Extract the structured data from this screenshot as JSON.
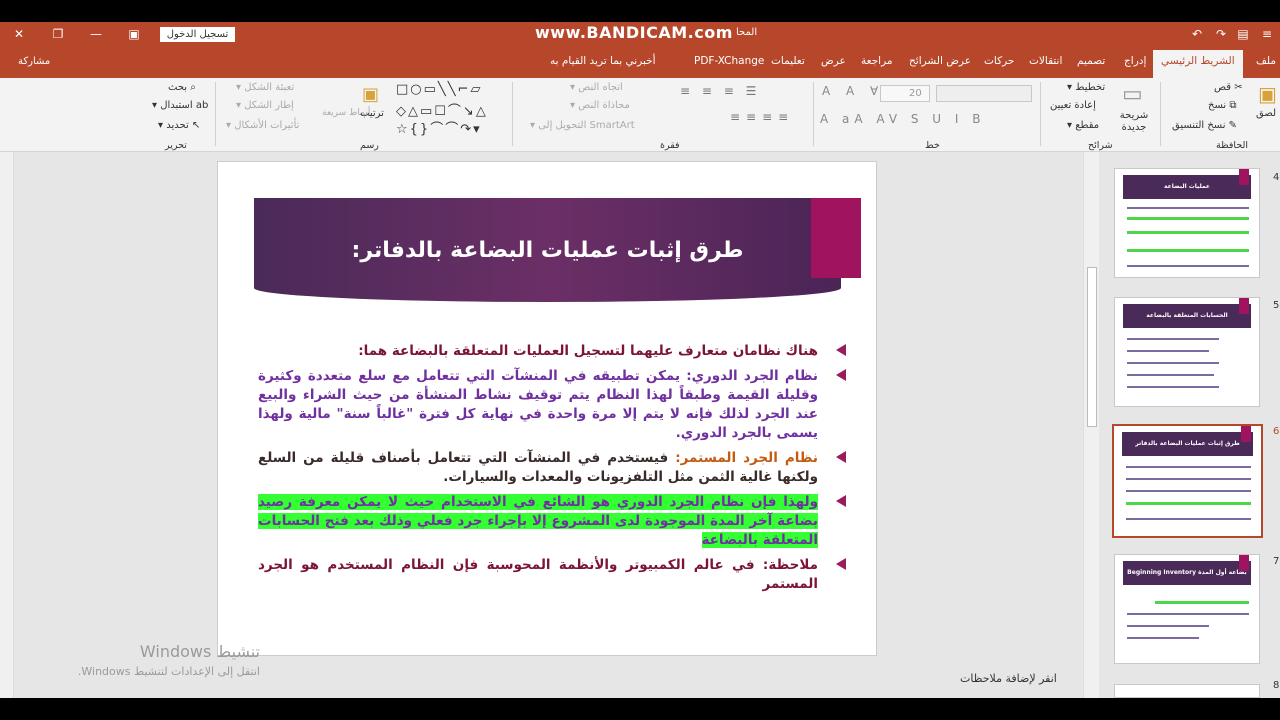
{
  "titlebar": {
    "login_label": "تسجيل الدخول",
    "watermark": "www.BANDICAM.com",
    "doc_title": "المحا"
  },
  "tabs": {
    "share_label": "مشاركة",
    "items": [
      "ملف",
      "الشريط الرئيسي",
      "إدراج",
      "تصميم",
      "انتقالات",
      "حركات",
      "عرض الشرائح",
      "مراجعة",
      "عرض",
      "تعليمات",
      "PDF-XChange",
      "أخبرني بما تريد القيام به"
    ]
  },
  "ribbon": {
    "clipboard": {
      "label": "الحافظة",
      "paste": "لصق",
      "cut": "قص",
      "copy": "نسخ",
      "format_painter": "نسخ التنسيق"
    },
    "slides": {
      "label": "شرائح",
      "new_slide": "شريحة جديدة",
      "layout": "تخطيط",
      "reset": "إعادة تعيين",
      "section": "مقطع"
    },
    "font": {
      "label": "خط",
      "size": "20"
    },
    "paragraph": {
      "label": "فقرة",
      "text_direction": "اتجاه النص",
      "align_text": "محاذاة النص",
      "smartart": "التحويل إلى SmartArt"
    },
    "drawing": {
      "label": "رسم",
      "arrange": "ترتيب",
      "quick_styles": "أنماط سريعة",
      "shape_fill": "تعبئة الشكل",
      "shape_outline": "إطار الشكل",
      "shape_effects": "تأثيرات الأشكال"
    },
    "editing": {
      "label": "تحرير",
      "find": "بحث",
      "replace": "استبدال",
      "select": "تحديد"
    }
  },
  "slide": {
    "title": "طرق إثبات عمليات البضاعة بالدفاتر:",
    "bullets": [
      {
        "text": "هناك نظامان متعارف عليهما لتسجيل العمليات المتعلقة بالبضاعة هما:"
      },
      {
        "lead": "نظام الجرد الدوري:",
        "text": " يمكن تطبيقه في المنشآت التي تتعامل مع سلع متعددة وكثيرة وقليلة القيمة وطبقاً لهذا النظام يتم توقيف نشاط المنشأة من حيث الشراء والبيع عند الجرد لذلك فإنه لا يتم إلا مرة واحدة في نهاية كل فترة \"غالباً سنة\" مالية ولهذا يسمى بالجرد الدوري."
      },
      {
        "lead": "نظام الجرد المستمر:",
        "text": " فيستخدم في المنشآت التي تتعامل بأصناف قليلة من السلع ولكنها غالية الثمن مثل التلفزيونات والمعدات والسيارات."
      },
      {
        "text": "ولهذا فإن نظام الجرد الدوري هو الشائع في الاستخدام حيث لا يمكن معرفة رصيد بضاعة آخر المدة الموجودة لدى المشروع إلا بإجراء جرد فعلي وذلك بعد فتح الحسابات المتعلقة بالبضاعة"
      },
      {
        "text": "ملاحظة: في عالم الكمبيوتر والأنظمة المحوسبة فإن النظام المستخدم هو الجرد المستمر"
      }
    ]
  },
  "thumbnails": [
    {
      "number": "4",
      "title": "عمليات البضاعة"
    },
    {
      "number": "5",
      "title": "الحسابات المتعلقة بالبضاعة"
    },
    {
      "number": "6",
      "title": "طرق إثبات عمليات البضاعة بالدفاتر"
    },
    {
      "number": "7",
      "title": "Beginning Inventory بضاعة أول المدة"
    },
    {
      "number": "8",
      "title": ""
    }
  ],
  "windows_activation": {
    "title": "تنشيط Windows",
    "subtitle": "انتقل إلى الإعدادات لتنشيط Windows."
  },
  "notes_placeholder": "انقر لإضافة ملاحظات"
}
